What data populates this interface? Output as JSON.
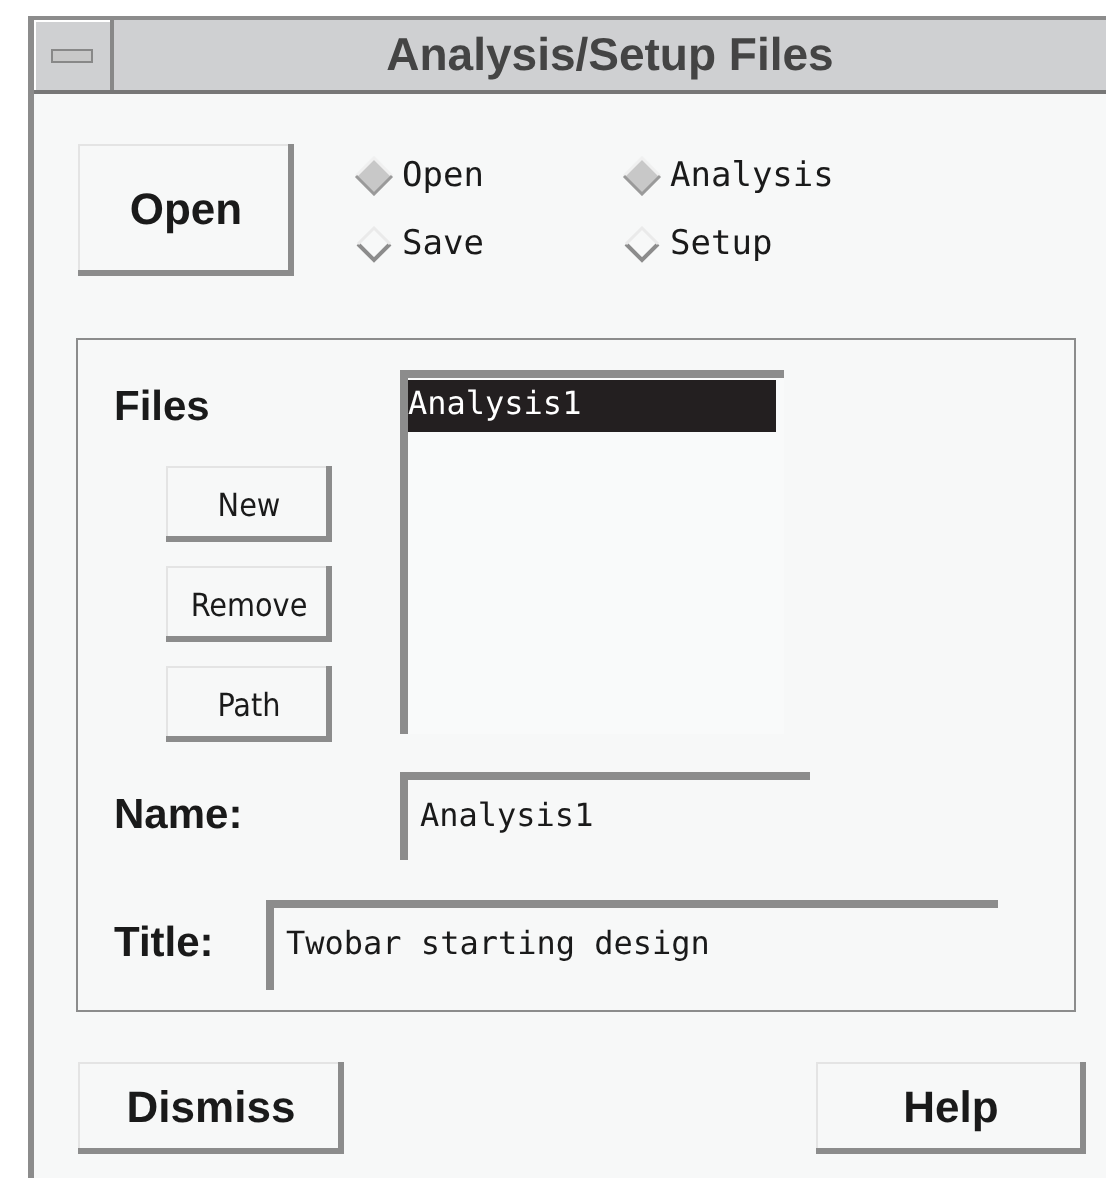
{
  "window": {
    "title": "Analysis/Setup Files"
  },
  "action_button": "Open",
  "mode_options": [
    {
      "label": "Open",
      "selected": true
    },
    {
      "label": "Save",
      "selected": false
    }
  ],
  "type_options": [
    {
      "label": "Analysis",
      "selected": true
    },
    {
      "label": "Setup",
      "selected": false
    }
  ],
  "files": {
    "label": "Files",
    "buttons": [
      "New",
      "Remove",
      "Path"
    ],
    "items": [
      {
        "label": "Analysis1",
        "selected": true
      }
    ]
  },
  "name_field": {
    "label": "Name:",
    "value": "Analysis1"
  },
  "title_field": {
    "label": "Title:",
    "value": "Twobar starting design"
  },
  "buttons": [
    "Dismiss",
    "Help"
  ]
}
